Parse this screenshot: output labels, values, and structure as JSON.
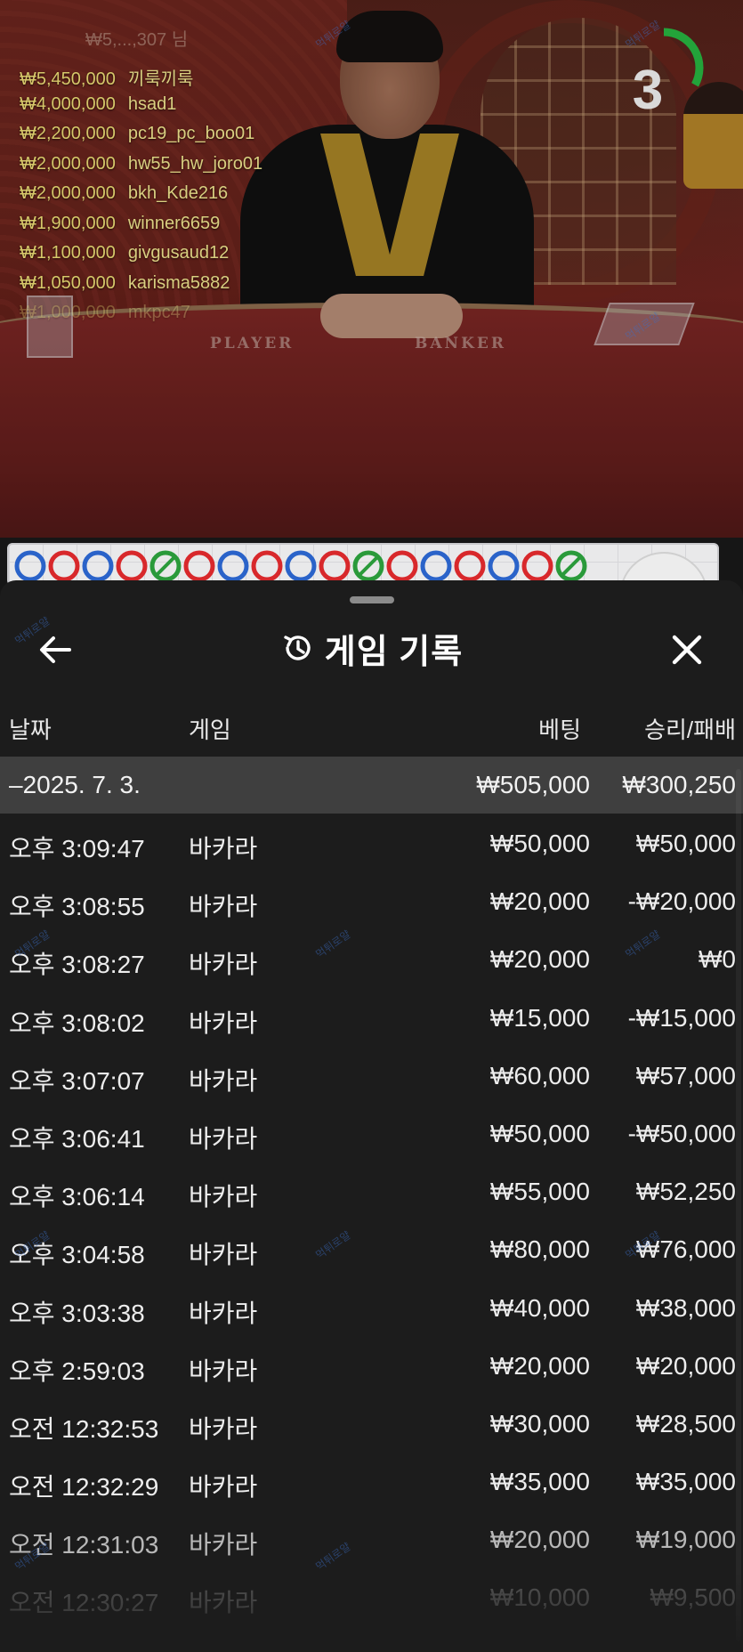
{
  "live_video": {
    "winners_header": "₩5,...,307 님",
    "winners": [
      {
        "amount": "₩5,450,000",
        "name": "끼룩끼룩"
      },
      {
        "amount": "₩4,000,000",
        "name": "hsad1"
      },
      {
        "amount": "₩2,200,000",
        "name": "pc19_pc_boo01"
      },
      {
        "amount": "₩2,000,000",
        "name": "hw55_hw_joro01"
      },
      {
        "amount": "₩2,000,000",
        "name": "bkh_Kde216"
      },
      {
        "amount": "₩1,900,000",
        "name": "winner6659"
      },
      {
        "amount": "₩1,100,000",
        "name": "givgusaud12"
      },
      {
        "amount": "₩1,050,000",
        "name": "karisma5882"
      },
      {
        "amount": "₩1,000,000",
        "name": "mkpc47"
      }
    ],
    "table_labels": {
      "player": "PLAYER",
      "banker": "BANKER"
    },
    "countdown": "3",
    "countdown_fraction": 0.33
  },
  "road": {
    "results": [
      "P",
      "B",
      "P",
      "B",
      "T",
      "B",
      "P",
      "B",
      "P",
      "B",
      "T",
      "B",
      "P",
      "B",
      "P",
      "B",
      "T"
    ],
    "colors": {
      "P": "#2a63c9",
      "B": "#d8282b",
      "T": "#2a9a3a"
    }
  },
  "history": {
    "title": "게임 기록",
    "icons": {
      "back": "arrow-left-icon",
      "title": "history-clock-icon",
      "close": "close-x-icon"
    },
    "columns": {
      "date": "날짜",
      "game": "게임",
      "bet": "베팅",
      "result": "승리/패배"
    },
    "date_group": {
      "date": "–2025. 7. 3.",
      "bet_total": "₩505,000",
      "result_total": "₩300,250"
    },
    "rows": [
      {
        "time": "오후 3:09:47",
        "game": "바카라",
        "bet": "₩50,000",
        "result": "₩50,000"
      },
      {
        "time": "오후 3:08:55",
        "game": "바카라",
        "bet": "₩20,000",
        "result": "-₩20,000"
      },
      {
        "time": "오후 3:08:27",
        "game": "바카라",
        "bet": "₩20,000",
        "result": "₩0"
      },
      {
        "time": "오후 3:08:02",
        "game": "바카라",
        "bet": "₩15,000",
        "result": "-₩15,000"
      },
      {
        "time": "오후 3:07:07",
        "game": "바카라",
        "bet": "₩60,000",
        "result": "₩57,000"
      },
      {
        "time": "오후 3:06:41",
        "game": "바카라",
        "bet": "₩50,000",
        "result": "-₩50,000"
      },
      {
        "time": "오후 3:06:14",
        "game": "바카라",
        "bet": "₩55,000",
        "result": "₩52,250"
      },
      {
        "time": "오후 3:04:58",
        "game": "바카라",
        "bet": "₩80,000",
        "result": "₩76,000"
      },
      {
        "time": "오후 3:03:38",
        "game": "바카라",
        "bet": "₩40,000",
        "result": "₩38,000"
      },
      {
        "time": "오후 2:59:03",
        "game": "바카라",
        "bet": "₩20,000",
        "result": "₩20,000"
      },
      {
        "time": "오전 12:32:53",
        "game": "바카라",
        "bet": "₩30,000",
        "result": "₩28,500"
      },
      {
        "time": "오전 12:32:29",
        "game": "바카라",
        "bet": "₩35,000",
        "result": "₩35,000"
      },
      {
        "time": "오전 12:31:03",
        "game": "바카라",
        "bet": "₩20,000",
        "result": "₩19,000"
      },
      {
        "time": "오전 12:30:27",
        "game": "바카라",
        "bet": "₩10,000",
        "result": "₩9,500"
      }
    ]
  },
  "watermark": "먹튀로얄"
}
